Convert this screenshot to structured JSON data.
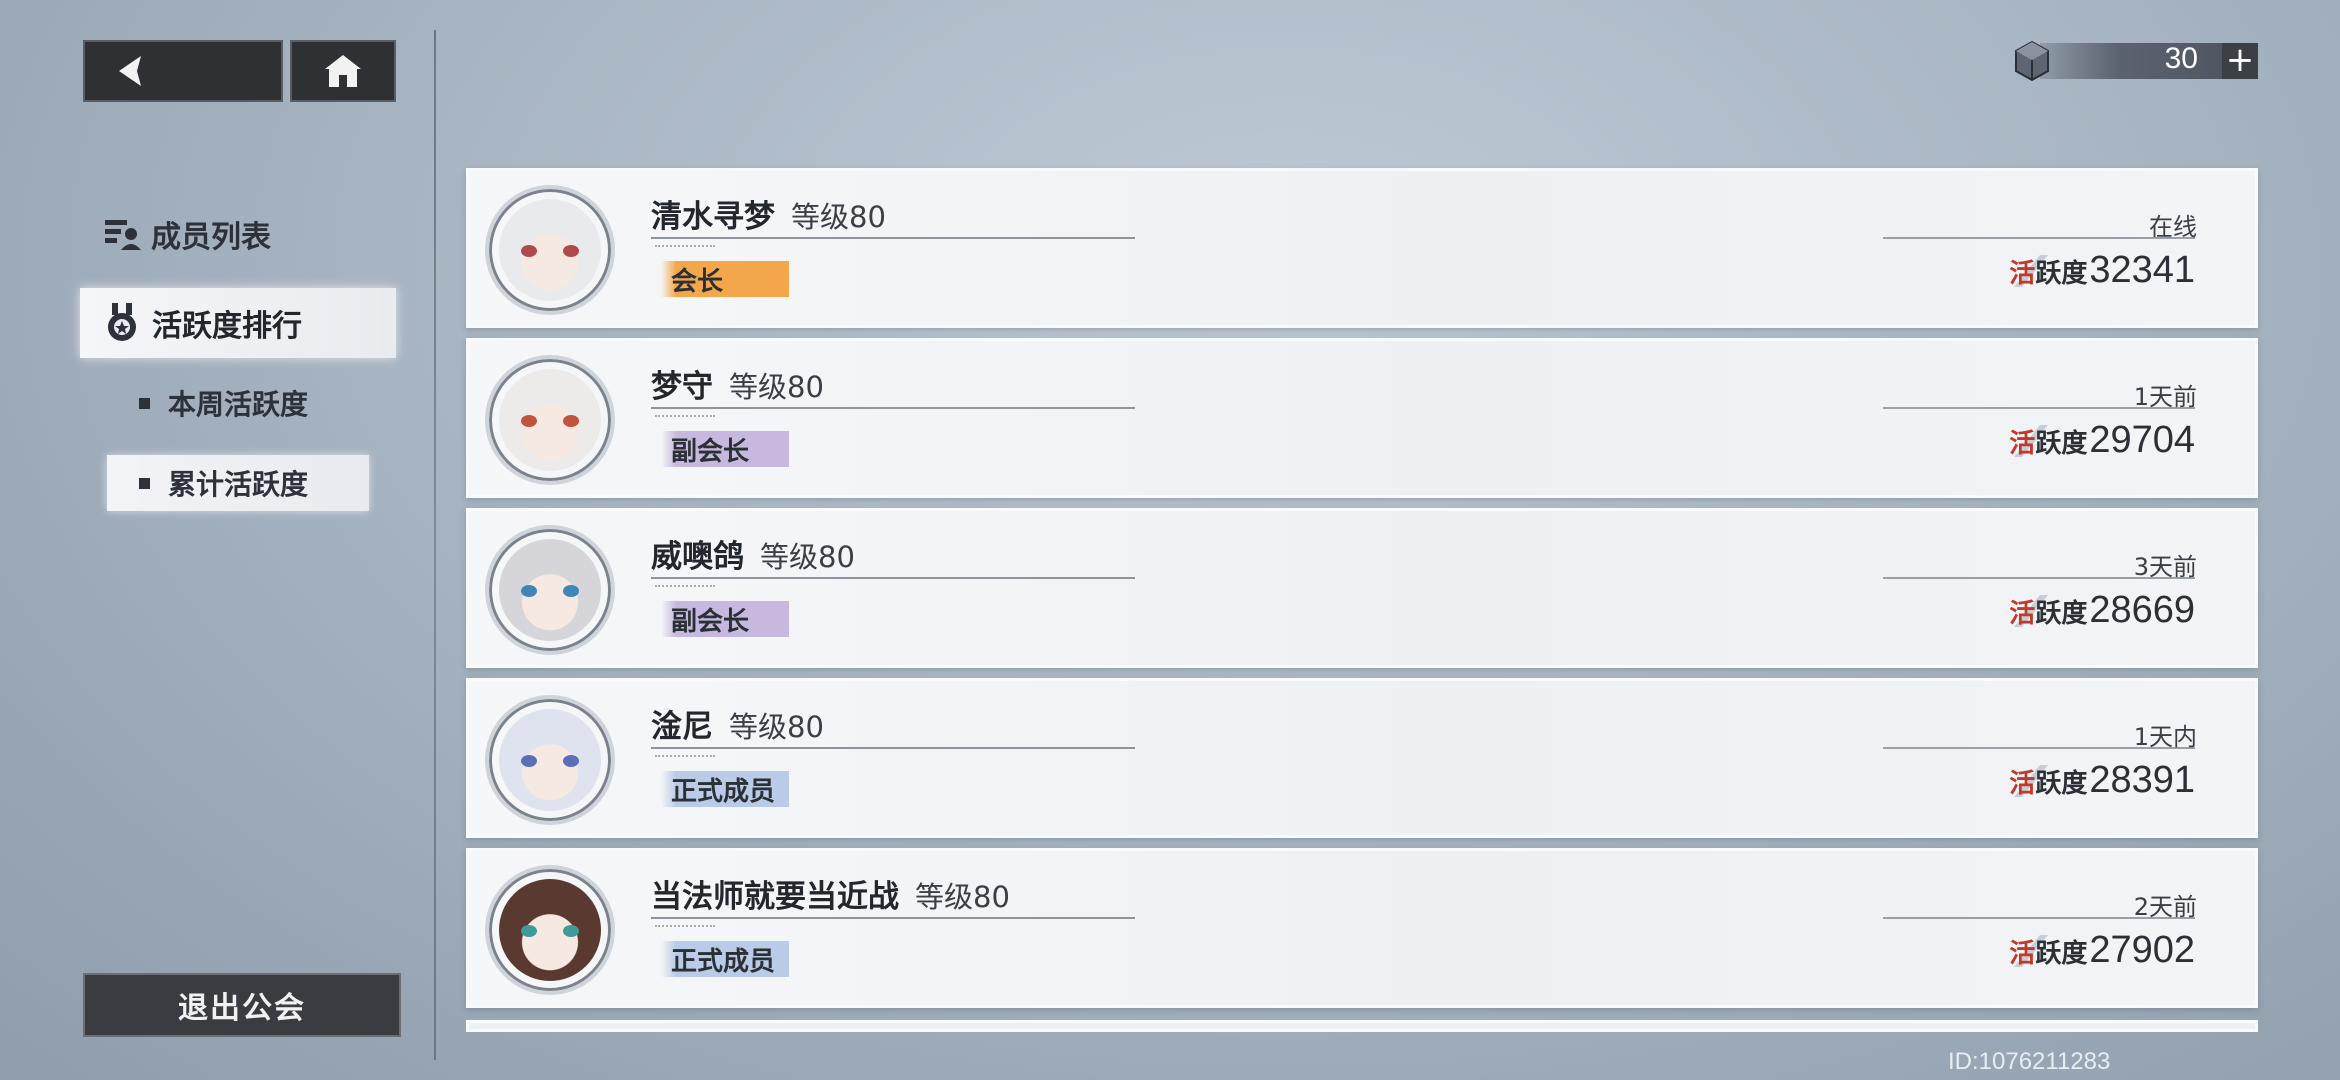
{
  "nav": {
    "back_icon": "chevron-left-icon",
    "home_icon": "home-icon"
  },
  "currency": {
    "value": "30",
    "plus": "+",
    "icon": "cube-gem-icon"
  },
  "sidebar": {
    "title": "成员列表",
    "active_item": "活跃度排行",
    "sub_items": [
      {
        "label": "本周活跃度",
        "selected": false
      },
      {
        "label": "累计活跃度",
        "selected": true
      }
    ],
    "exit_label": "退出公会"
  },
  "members": [
    {
      "name": "清水寻梦",
      "level": "等级80",
      "role": "会长",
      "role_color": "#f4a64a",
      "status": "在线",
      "activity_label_accent": "活",
      "activity_label_rest": "跃度",
      "activity": "32341",
      "avatar_hair": "#e9eaec",
      "avatar_eye": "#b04a4a"
    },
    {
      "name": "梦守",
      "level": "等级80",
      "role": "副会长",
      "role_color": "#c6b8de",
      "status": "1天前",
      "activity_label_accent": "活",
      "activity_label_rest": "跃度",
      "activity": "29704",
      "avatar_hair": "#ecebea",
      "avatar_eye": "#c0543c"
    },
    {
      "name": "威噢鸽",
      "level": "等级80",
      "role": "副会长",
      "role_color": "#c6b8de",
      "status": "3天前",
      "activity_label_accent": "活",
      "activity_label_rest": "跃度",
      "activity": "28669",
      "avatar_hair": "#d6d6da",
      "avatar_eye": "#3f86b8"
    },
    {
      "name": "淦尼",
      "level": "等级80",
      "role": "正式成员",
      "role_color": "#b9cbe6",
      "status": "1天内",
      "activity_label_accent": "活",
      "activity_label_rest": "跃度",
      "activity": "28391",
      "avatar_hair": "#dfe3ef",
      "avatar_eye": "#5a6fb8"
    },
    {
      "name": "当法师就要当近战",
      "level": "等级80",
      "role": "正式成员",
      "role_color": "#b9cbe6",
      "status": "2天前",
      "activity_label_accent": "活",
      "activity_label_rest": "跃度",
      "activity": "27902",
      "avatar_hair": "#5a3a30",
      "avatar_eye": "#3f9a9a"
    }
  ],
  "footer": {
    "uid": "ID:1076211283"
  }
}
